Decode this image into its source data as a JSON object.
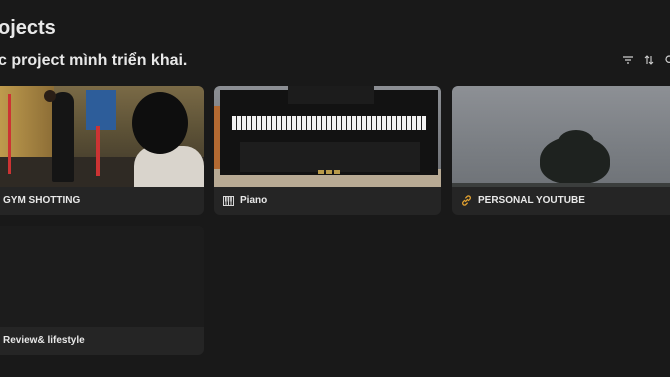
{
  "page": {
    "title": "ojects",
    "subtitle": "c project mình triển khai."
  },
  "toolbar": {
    "filter_icon": "filter-icon",
    "sort_icon": "sort-icon",
    "search_icon": "search-icon"
  },
  "cards": [
    {
      "title": "GYM SHOTTING",
      "icon": "none",
      "cover": "gym-photo"
    },
    {
      "title": "Piano",
      "icon": "piano-icon",
      "cover": "piano-photo"
    },
    {
      "title": "PERSONAL YOUTUBE",
      "icon": "link-icon",
      "icon_color": "#e0a030",
      "cover": "tree-sky-photo"
    },
    {
      "title": "Review& lifestyle",
      "icon": "none",
      "cover": "empty"
    }
  ],
  "colors": {
    "background": "#191919",
    "card": "#252525",
    "text": "#e8e8e8"
  }
}
